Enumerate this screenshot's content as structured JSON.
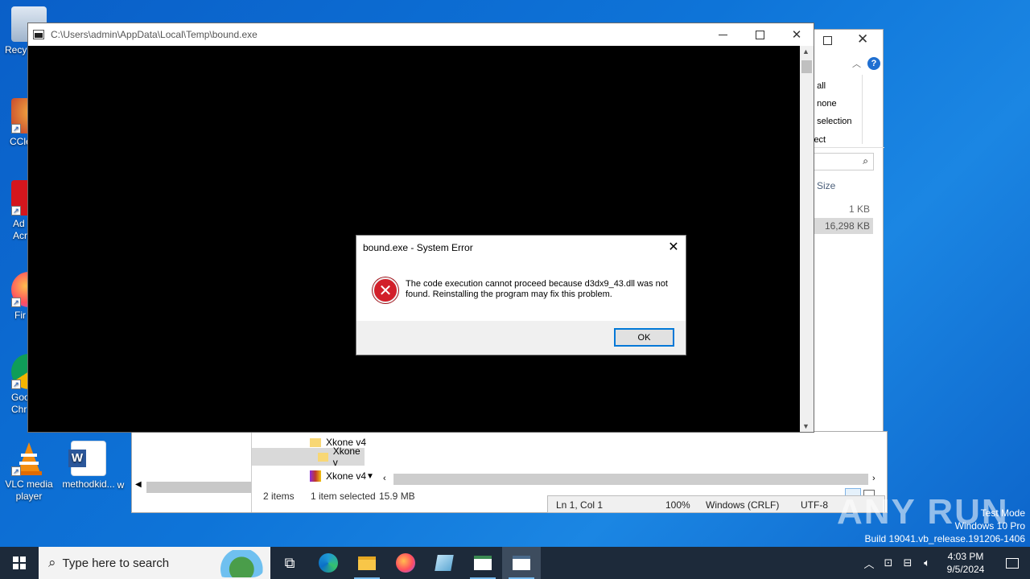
{
  "desktop": {
    "icons": [
      {
        "label": "Recy",
        "icon": "recycle-bin-icon"
      },
      {
        "label": "CCle",
        "icon": "ccleaner-icon"
      },
      {
        "label": "Ad\nAcr",
        "icon": "adobe-acrobat-icon"
      },
      {
        "label": "Fir",
        "icon": "firefox-icon"
      },
      {
        "label": "Goo\nChr",
        "icon": "chrome-icon"
      },
      {
        "label": "VLC media player",
        "icon": "vlc-icon"
      },
      {
        "label": "methodkid...",
        "icon": "word-doc-icon"
      },
      {
        "label": "w",
        "icon": "partial-icon"
      }
    ]
  },
  "explorer": {
    "ribbon_items": [
      "t all",
      "t none",
      "t selection",
      "lect"
    ],
    "help": "?",
    "column_size": "Size",
    "sizes": [
      "1 KB",
      "16,298 KB"
    ],
    "tree_items": [
      "Xkone v4",
      "Xkone v",
      "Xkone v4"
    ],
    "status_items": "2 items",
    "status_selected": "1 item selected",
    "status_size": "15.9 MB"
  },
  "notepad": {
    "status": [
      "Ln 1, Col 1",
      "100%",
      "Windows (CRLF)",
      "UTF-8"
    ]
  },
  "console": {
    "title": "C:\\Users\\admin\\AppData\\Local\\Temp\\bound.exe"
  },
  "dialog": {
    "title": "bound.exe - System Error",
    "message": "The code execution cannot proceed because d3dx9_43.dll was not found. Reinstalling the program may fix this problem.",
    "ok_label": "OK"
  },
  "taskbar": {
    "search_placeholder": "Type here to search",
    "time": "4:03 PM",
    "date": "9/5/2024"
  },
  "watermark": {
    "line1": "Test Mode",
    "line2": "Windows 10 Pro",
    "line3": "Build 19041.vb_release.191206-1406",
    "brand": "ANY RUN"
  },
  "colors": {
    "desktop": "#0e74d8",
    "taskbar": "#1d2a3a",
    "error_red": "#d21f2a",
    "accent": "#0078d7"
  }
}
